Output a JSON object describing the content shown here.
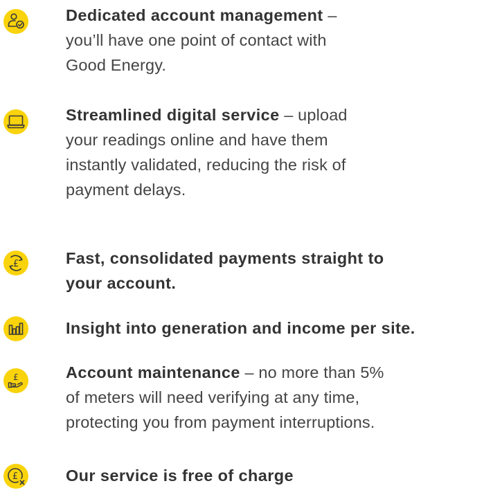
{
  "colors": {
    "icon_fill": "#F9D30B",
    "icon_stroke": "#3A3A3A",
    "heading_text": "#333333",
    "body_text": "#444444"
  },
  "features": [
    {
      "icon": "user-check-icon",
      "title": "Dedicated account management",
      "separator": " –",
      "lines": [
        "you’ll have one point of contact with",
        "Good Energy."
      ]
    },
    {
      "icon": "laptop-icon",
      "title": "Streamlined digital service",
      "separator": " – upload",
      "lines": [
        "your readings online and have them",
        "instantly validated, reducing the risk of",
        "payment delays."
      ]
    },
    {
      "icon": "pound-refresh-icon",
      "title_lines": [
        "Fast, consolidated payments straight to",
        "your account."
      ]
    },
    {
      "icon": "bar-chart-icon",
      "title": "Insight into generation and income per site."
    },
    {
      "icon": "pound-hand-icon",
      "title": "Account maintenance",
      "separator": " –  no more than 5%",
      "lines": [
        "of meters will need verifying at any time,",
        "protecting you from payment interruptions."
      ]
    },
    {
      "icon": "pound-cross-icon",
      "title": "Our service is free of charge"
    }
  ]
}
